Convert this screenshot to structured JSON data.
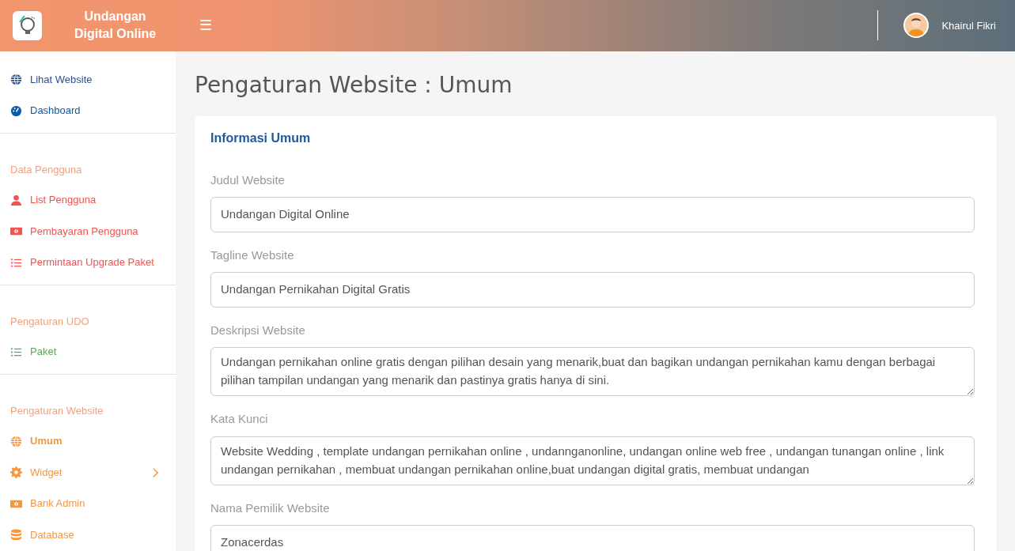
{
  "brand": {
    "title_lines": [
      "Undangan",
      "Digital Online"
    ]
  },
  "menu_toggle": "☰",
  "user": {
    "name": "Khairul Fikri"
  },
  "sidebar": {
    "sections": [
      {
        "items": [
          {
            "label": "Lihat Website",
            "kind": "globe",
            "color": "#2c4f8f",
            "selected": false,
            "has_submenu": false
          },
          {
            "label": "Dashboard",
            "kind": "gauge",
            "color": "#0e5aa8",
            "selected": false,
            "has_submenu": false
          }
        ]
      },
      {
        "heading": "Data Pengguna",
        "items": [
          {
            "label": "List Pengguna",
            "kind": "user",
            "color": "#f4524f",
            "selected": false,
            "has_submenu": false
          },
          {
            "label": "Pembayaran Pengguna",
            "kind": "money",
            "color": "#f4524f",
            "selected": false,
            "has_submenu": false
          },
          {
            "label": "Permintaan Upgrade Paket",
            "kind": "list",
            "color": "#f4524f",
            "selected": false,
            "has_submenu": false
          }
        ]
      },
      {
        "heading": "Pengaturan UDO",
        "items": [
          {
            "label": "Paket",
            "kind": "list",
            "color": "#4caf50",
            "selected": false,
            "has_submenu": false
          }
        ]
      },
      {
        "heading": "Pengaturan Website",
        "items": [
          {
            "label": "Umum",
            "kind": "globe",
            "color": "#f7963a",
            "selected": true,
            "has_submenu": false
          },
          {
            "label": "Widget",
            "kind": "gear",
            "color": "#f7963a",
            "selected": false,
            "has_submenu": true
          },
          {
            "label": "Bank Admin",
            "kind": "money",
            "color": "#f7963a",
            "selected": false,
            "has_submenu": false
          },
          {
            "label": "Database",
            "kind": "database",
            "color": "#f7963a",
            "selected": false,
            "has_submenu": false
          }
        ]
      }
    ]
  },
  "page_title": "Pengaturan Website : Umum",
  "card": {
    "title": "Informasi Umum",
    "fields": [
      {
        "label": "Judul Website",
        "kind": "input",
        "value": "Undangan Digital Online"
      },
      {
        "label": "Tagline Website",
        "kind": "input",
        "value": "Undangan Pernikahan Digital Gratis"
      },
      {
        "label": "Deskripsi Website",
        "kind": "textarea",
        "value": "Undangan pernikahan online gratis dengan pilihan desain yang menarik,buat dan bagikan undangan pernikahan kamu dengan berbagai pilihan tampilan undangan yang menarik dan pastinya gratis hanya di sini."
      },
      {
        "label": "Kata Kunci",
        "kind": "textarea",
        "value": "Website Wedding , template undangan pernikahan online , undannganonline, undangan online web free , undangan tunangan online , link undangan pernikahan , membuat undangan pernikahan online,buat undangan digital gratis, membuat undangan"
      },
      {
        "label": "Nama Pemilik Website",
        "kind": "input",
        "value": "Zonacerdas"
      }
    ]
  }
}
